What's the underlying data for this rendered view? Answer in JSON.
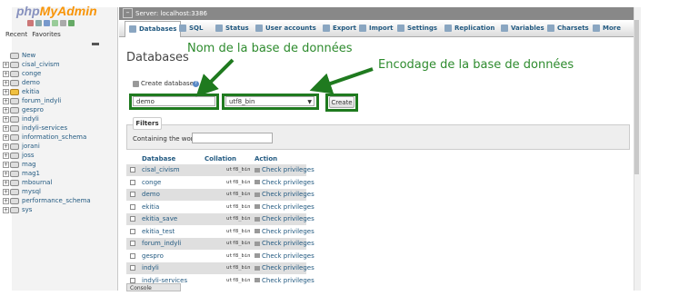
{
  "logo": {
    "php": "php",
    "my": "My",
    "admin": "Admin"
  },
  "left_tabs": [
    "Recent",
    "Favorites"
  ],
  "databases_tree": [
    {
      "label": "New",
      "icon": "new"
    },
    {
      "label": "cisal_civism"
    },
    {
      "label": "conge"
    },
    {
      "label": "demo"
    },
    {
      "label": "ekitia",
      "warn": true
    },
    {
      "label": "forum_indyli"
    },
    {
      "label": "gespro"
    },
    {
      "label": "indyli"
    },
    {
      "label": "indyli-services"
    },
    {
      "label": "information_schema"
    },
    {
      "label": "jorani"
    },
    {
      "label": "joss"
    },
    {
      "label": "mag"
    },
    {
      "label": "mag1"
    },
    {
      "label": "mbournal"
    },
    {
      "label": "mysql"
    },
    {
      "label": "performance_schema"
    },
    {
      "label": "sys"
    }
  ],
  "server_bar": {
    "label": "Server: localhost:3386"
  },
  "tabs": [
    {
      "label": "Databases",
      "active": true
    },
    {
      "label": "SQL"
    },
    {
      "label": "Status"
    },
    {
      "label": "User accounts"
    },
    {
      "label": "Export"
    },
    {
      "label": "Import"
    },
    {
      "label": "Settings"
    },
    {
      "label": "Replication"
    },
    {
      "label": "Variables"
    },
    {
      "label": "Charsets"
    },
    {
      "label": "More"
    }
  ],
  "page_title": "Databases",
  "create": {
    "label": "Create database",
    "db_name_value": "demo",
    "collation_value": "utf8_bin",
    "button": "Create"
  },
  "annotations": {
    "db_name": "Nom de la base de données",
    "encoding": "Encodage de la base de données"
  },
  "filters": {
    "legend": "Filters",
    "containing_label": "Containing the word:"
  },
  "table": {
    "headers": {
      "database": "Database",
      "collation": "Collation",
      "action": "Action"
    },
    "rows": [
      {
        "name": "cisal_civism",
        "collation": "utf8_bin",
        "action": "Check privileges"
      },
      {
        "name": "conge",
        "collation": "utf8_bin",
        "action": "Check privileges"
      },
      {
        "name": "demo",
        "collation": "utf8_bin",
        "action": "Check privileges"
      },
      {
        "name": "ekitia",
        "collation": "utf8_bin",
        "action": "Check privileges"
      },
      {
        "name": "ekitia_save",
        "collation": "utf8_bin",
        "action": "Check privileges"
      },
      {
        "name": "ekitia_test",
        "collation": "utf8_bin",
        "action": "Check privileges"
      },
      {
        "name": "forum_indyli",
        "collation": "utf8_bin",
        "action": "Check privileges"
      },
      {
        "name": "gespro",
        "collation": "utf8_bin",
        "action": "Check privileges"
      },
      {
        "name": "indyli",
        "collation": "utf8_bin",
        "action": "Check privileges"
      },
      {
        "name": "indyli-services",
        "collation": "utf8_bin",
        "action": "Check privileges"
      }
    ]
  },
  "console": "Console",
  "colors": {
    "annotation_green": "#2e8b2e",
    "box_green": "#1f7a1f",
    "link_blue": "#235a81"
  }
}
